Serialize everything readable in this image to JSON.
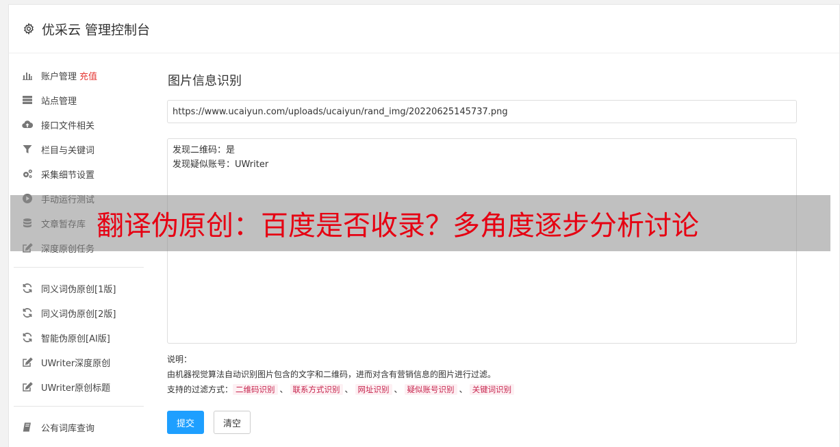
{
  "header": {
    "title": "优采云 管理控制台",
    "icon": "gear-icon"
  },
  "sidebar": {
    "group1": [
      {
        "label": "账户管理",
        "badge": "充值",
        "icon": "bar-chart-icon"
      },
      {
        "label": "站点管理",
        "icon": "server-icon"
      },
      {
        "label": "接口文件相关",
        "icon": "cloud-upload-icon"
      },
      {
        "label": "栏目与关键词",
        "icon": "filter-icon"
      },
      {
        "label": "采集细节设置",
        "icon": "cogs-icon"
      },
      {
        "label": "手动运行测试",
        "icon": "play-circle-icon"
      },
      {
        "label": "文章暂存库",
        "icon": "database-icon"
      },
      {
        "label": "深度原创任务",
        "icon": "edit-icon"
      }
    ],
    "group2": [
      {
        "label": "同义词伪原创[1版]",
        "icon": "refresh-icon"
      },
      {
        "label": "同义词伪原创[2版]",
        "icon": "refresh-icon"
      },
      {
        "label": "智能伪原创[AI版]",
        "icon": "refresh-icon"
      },
      {
        "label": "UWriter深度原创",
        "icon": "edit-icon"
      },
      {
        "label": "UWriter原创标题",
        "icon": "edit-icon"
      }
    ],
    "group3": [
      {
        "label": "公有词库查询",
        "icon": "book-icon"
      }
    ]
  },
  "main": {
    "title": "图片信息识别",
    "url_value": "https://www.ucaiyun.com/uploads/ucaiyun/rand_img/20220625145737.png",
    "result_lines": [
      "发现二维码：是",
      "发现疑似账号：UWriter"
    ],
    "notes_label": "说明：",
    "notes_desc": "由机器视觉算法自动识别图片包含的文字和二维码，进而对含有营销信息的图片进行过滤。",
    "filter_label": "支持的过滤方式：",
    "filters": [
      "二维码识别",
      "联系方式识别",
      "网址识别",
      "疑似账号识别",
      "关键词识别"
    ],
    "filter_sep": "、",
    "submit_label": "提交",
    "clear_label": "清空"
  },
  "banner": {
    "text": "翻译伪原创：百度是否收录？多角度逐步分析讨论"
  },
  "colors": {
    "primary": "#1e9fff",
    "recharge": "#e53935",
    "banner_text": "#e60012",
    "tag_text": "#c7254e"
  }
}
